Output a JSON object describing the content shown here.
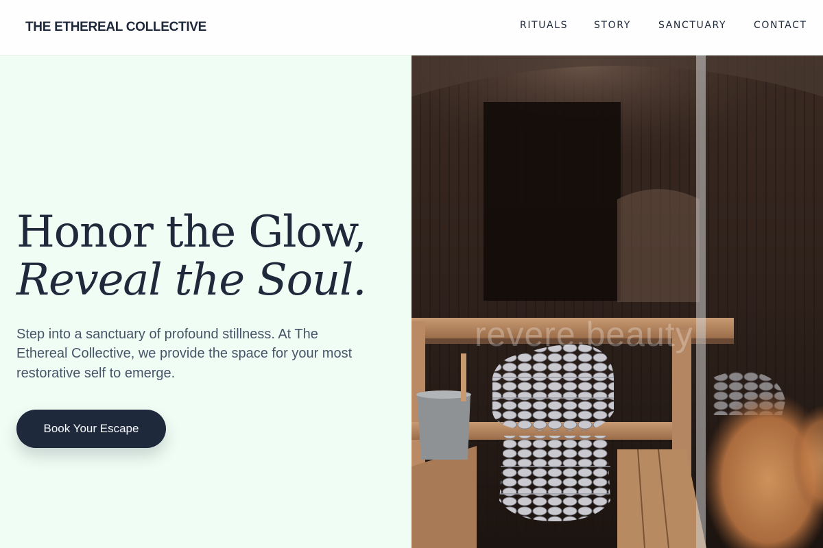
{
  "header": {
    "brand": "THE ETHEREAL COLLECTIVE",
    "nav": [
      "RITUALS",
      "STORY",
      "SANCTUARY",
      "CONTACT"
    ]
  },
  "hero": {
    "headline_line1": "Honor the Glow,",
    "headline_line2": "Reveal the Soul.",
    "intro": "Step into a sanctuary of profound stillness. At The Ethereal Collective, we provide the space for your most restorative self to emerge.",
    "cta_label": "Book Your Escape"
  },
  "image": {
    "subject": "sauna interior with wooden benches and stone heater",
    "watermark": "revere.beauty"
  },
  "colors": {
    "page_bg": "#f0fdf4",
    "header_bg": "#fdfefd",
    "text_dark": "#1e293b",
    "text_muted": "#475569",
    "button_bg": "#1e293b",
    "button_text": "#f8fafc"
  }
}
